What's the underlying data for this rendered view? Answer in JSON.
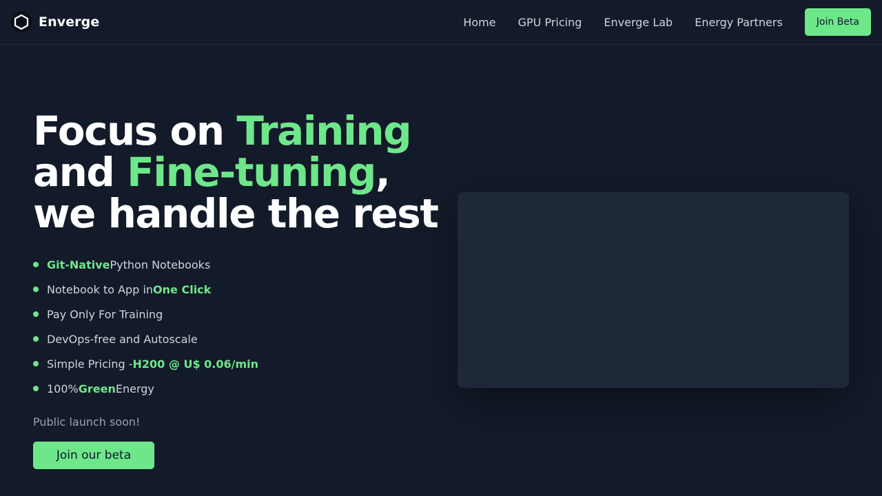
{
  "nav": {
    "brand": "Enverge",
    "logo_icon": "hexagon-icon",
    "links": [
      "Home",
      "GPU Pricing",
      "Enverge Lab",
      "Energy Partners"
    ],
    "cta": "Join Beta"
  },
  "hero": {
    "title": {
      "line1_a": "Focus on ",
      "line1_b": "Training",
      "line2_a": "and ",
      "line2_b": "Fine-tuning",
      "line2_c": ",",
      "line3": "we handle the rest"
    },
    "features": [
      {
        "parts": [
          "Git-Native",
          " Python Notebooks"
        ]
      },
      {
        "parts": [
          "Notebook to App in ",
          "One Click"
        ]
      },
      {
        "parts": [
          "Pay Only For Training"
        ]
      },
      {
        "parts": [
          "DevOps-free and Autoscale"
        ]
      },
      {
        "parts": [
          "Simple Pricing - ",
          "H200 @ U$ 0.06/min"
        ]
      },
      {
        "parts": [
          "100% ",
          "Green",
          " Energy"
        ]
      }
    ],
    "launch_note": "Public launch soon!",
    "cta": "Join our beta"
  },
  "colors": {
    "background": "#131a29",
    "accent": "#6ee78a",
    "panel": "#1f2838"
  }
}
